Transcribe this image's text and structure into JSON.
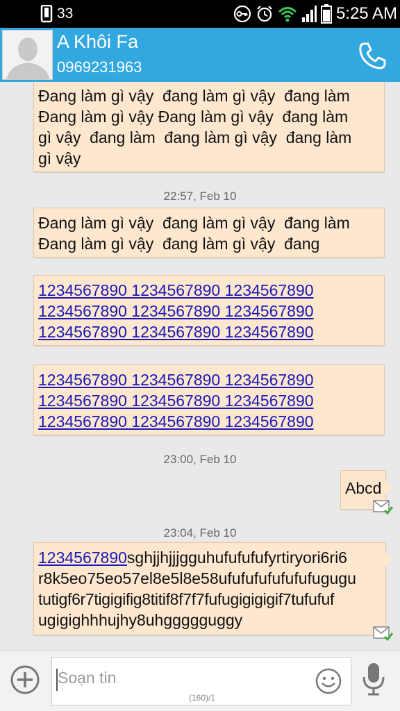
{
  "status_bar": {
    "left_count": "33",
    "time": "5:25 AM",
    "icons": [
      "phone-icon",
      "key-icon",
      "alarm-icon",
      "wifi-icon",
      "signal-icon",
      "battery-icon"
    ]
  },
  "header": {
    "contact_name": "A Khôi Fa",
    "phone_number": "0969231963",
    "accent_color": "#32a7e0"
  },
  "messages": [
    {
      "type": "received",
      "lines": [
        "Đang làm gì vậy  đang làm gì vậy  đang làm",
        "Đang làm gì vậy Đang làm gì vậy  đang làm",
        "gì vậy  đang làm  đang làm gì vậy  đang làm",
        "gì vậy"
      ]
    },
    {
      "type": "timestamp",
      "text": "22:57, Feb 10"
    },
    {
      "type": "received",
      "lines": [
        "Đang làm gì vậy  đang làm gì vậy  đang làm",
        "Đang làm gì vậy  đang làm gì vậy  đang"
      ]
    },
    {
      "type": "received",
      "lines": [
        "1234567890 1234567890 1234567890",
        "1234567890 1234567890 1234567890",
        "1234567890 1234567890 1234567890"
      ]
    },
    {
      "type": "received",
      "lines": [
        "1234567890 1234567890 1234567890",
        "1234567890 1234567890 1234567890",
        "1234567890 1234567890 1234567890"
      ]
    },
    {
      "type": "timestamp",
      "text": "23:00, Feb 10"
    },
    {
      "type": "sent",
      "text": "Abcd"
    },
    {
      "type": "timestamp",
      "text": "23:04, Feb 10"
    },
    {
      "type": "sent",
      "link": "1234567890",
      "first_line_rest": "sghjjhjjjgguhufufufufyrtiryori6ri6",
      "lines": [
        "r8k5eo75eo57el8e5l8e58ufufufufufufufugugu",
        "tutigf6r7tigigifig8titif8f7f7fufugigigigif7tufufuf",
        "ugigighhhujhy8uhggggguggy"
      ]
    }
  ],
  "compose": {
    "placeholder": "Soạn tin",
    "counter": "(160)/1"
  }
}
